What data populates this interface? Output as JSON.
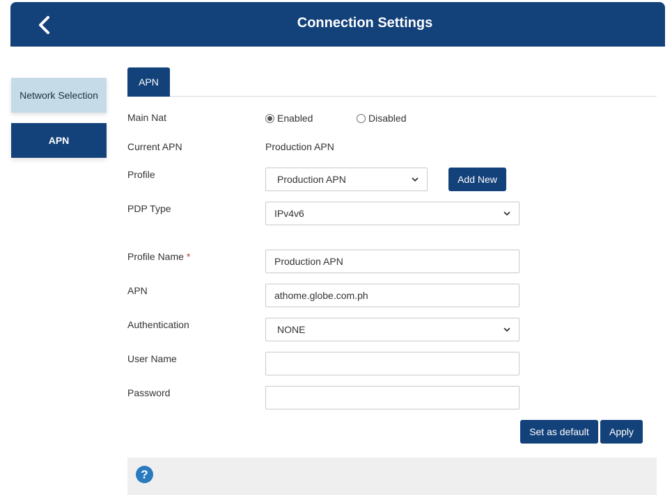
{
  "header": {
    "title": "Connection Settings",
    "back_icon": "chevron-left-icon"
  },
  "sidebar": {
    "items": [
      {
        "label": "Network Selection",
        "active": false
      },
      {
        "label": "APN",
        "active": true
      }
    ]
  },
  "tabs": [
    {
      "label": "APN",
      "active": true
    }
  ],
  "form": {
    "main_nat": {
      "label": "Main Nat",
      "options": [
        {
          "label": "Enabled",
          "checked": true
        },
        {
          "label": "Disabled",
          "checked": false
        }
      ]
    },
    "current_apn": {
      "label": "Current APN",
      "value": "Production APN"
    },
    "profile": {
      "label": "Profile",
      "selected": "Production APN",
      "add_new_label": "Add New"
    },
    "pdp_type": {
      "label": "PDP Type",
      "selected": "IPv4v6"
    },
    "profile_name": {
      "label": "Profile Name",
      "required_mark": "*",
      "value": "Production APN"
    },
    "apn": {
      "label": "APN",
      "value": "athome.globe.com.ph"
    },
    "authentication": {
      "label": "Authentication",
      "selected": "NONE"
    },
    "user_name": {
      "label": "User Name",
      "value": ""
    },
    "password": {
      "label": "Password",
      "value": ""
    }
  },
  "actions": {
    "set_default_label": "Set as default",
    "apply_label": "Apply"
  },
  "help": {
    "icon": "question-icon",
    "glyph": "?"
  },
  "colors": {
    "primary": "#13417a",
    "sidebar_inactive": "#c6dbe8",
    "help_icon": "#2a7ac0"
  }
}
